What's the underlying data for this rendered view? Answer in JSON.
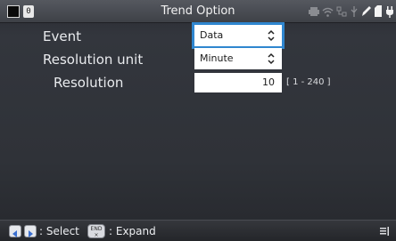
{
  "window": {
    "title": "Trend Option"
  },
  "status_bar": {
    "channel_badge": "0",
    "icons": [
      "printer-icon",
      "wifi-icon",
      "network-icon",
      "usb-icon",
      "pen-icon",
      "sd-card-icon",
      "power-plug-icon"
    ]
  },
  "form": {
    "event": {
      "label": "Event",
      "value": "Data"
    },
    "resolution_unit": {
      "label": "Resolution unit",
      "value": "Minute"
    },
    "resolution": {
      "label": "Resolution",
      "value": "10",
      "range_hint": "[ 1 - 240 ]"
    }
  },
  "footer": {
    "select_text": ": Select",
    "end_key_top": "END",
    "end_key_bottom": "×",
    "expand_text": ": Expand"
  },
  "colors": {
    "focus_outline": "#2f86cf",
    "background": "#2f3238"
  }
}
